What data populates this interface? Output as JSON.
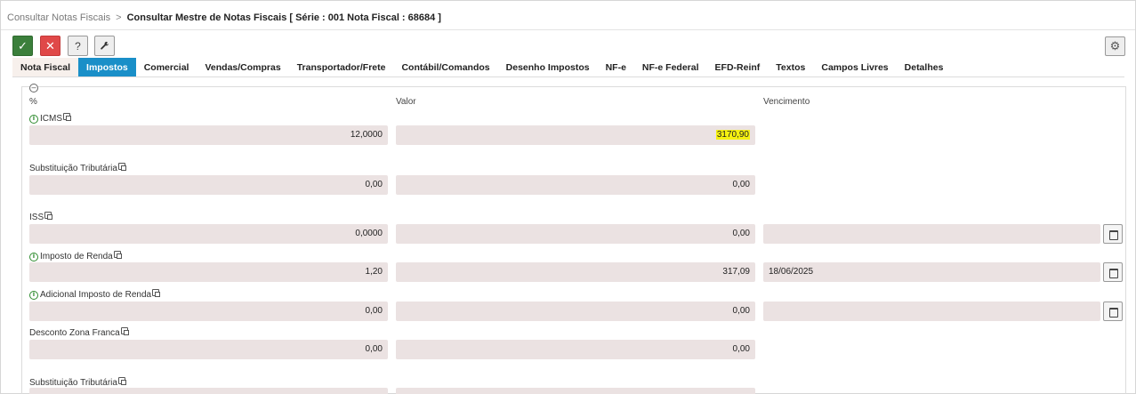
{
  "breadcrumb": {
    "parent": "Consultar Notas Fiscais",
    "separator": ">",
    "current": "Consultar Mestre de Notas Fiscais [ Série : 001 Nota Fiscal : 68684 ]"
  },
  "toolbar": {
    "confirm_glyph": "✓",
    "cancel_glyph": "✕",
    "help_glyph": "?",
    "tools_glyph": "🔧",
    "settings_glyph": "⚙"
  },
  "tabs": [
    {
      "label": "Nota Fiscal"
    },
    {
      "label": "Impostos"
    },
    {
      "label": "Comercial"
    },
    {
      "label": "Vendas/Compras"
    },
    {
      "label": "Transportador/Frete"
    },
    {
      "label": "Contábil/Comandos"
    },
    {
      "label": "Desenho Impostos"
    },
    {
      "label": "NF-e"
    },
    {
      "label": "NF-e Federal"
    },
    {
      "label": "EFD-Reinf"
    },
    {
      "label": "Textos"
    },
    {
      "label": "Campos Livres"
    },
    {
      "label": "Detalhes"
    }
  ],
  "active_tab": "Impostos",
  "columns": {
    "percent": "%",
    "value": "Valor",
    "due": "Vencimento"
  },
  "fields": [
    {
      "label": "ICMS",
      "percent": "12,0000",
      "value": "3170,90",
      "due": null
    },
    {
      "label": "Substituição Tributária",
      "percent": "0,00",
      "value": "0,00",
      "due": null
    },
    {
      "label": "ISS",
      "percent": "0,0000",
      "value": "0,00",
      "due": ""
    },
    {
      "label": "Imposto de Renda",
      "percent": "1,20",
      "value": "317,09",
      "due": "18/06/2025"
    },
    {
      "label": "Adicional Imposto de Renda",
      "percent": "0,00",
      "value": "0,00",
      "due": ""
    },
    {
      "label": "Desconto Zona Franca",
      "percent": "0,00",
      "value": "0,00",
      "due": null
    },
    {
      "label": "Substituição Tributária",
      "percent": "",
      "value": "",
      "due": null
    }
  ],
  "colors": {
    "accent": "#1a8fc8",
    "confirm": "#3b7f3b",
    "cancel": "#e04848",
    "info": "#2e8b2e",
    "highlight": "#f5f010",
    "field_bg": "#ebe2e2"
  }
}
